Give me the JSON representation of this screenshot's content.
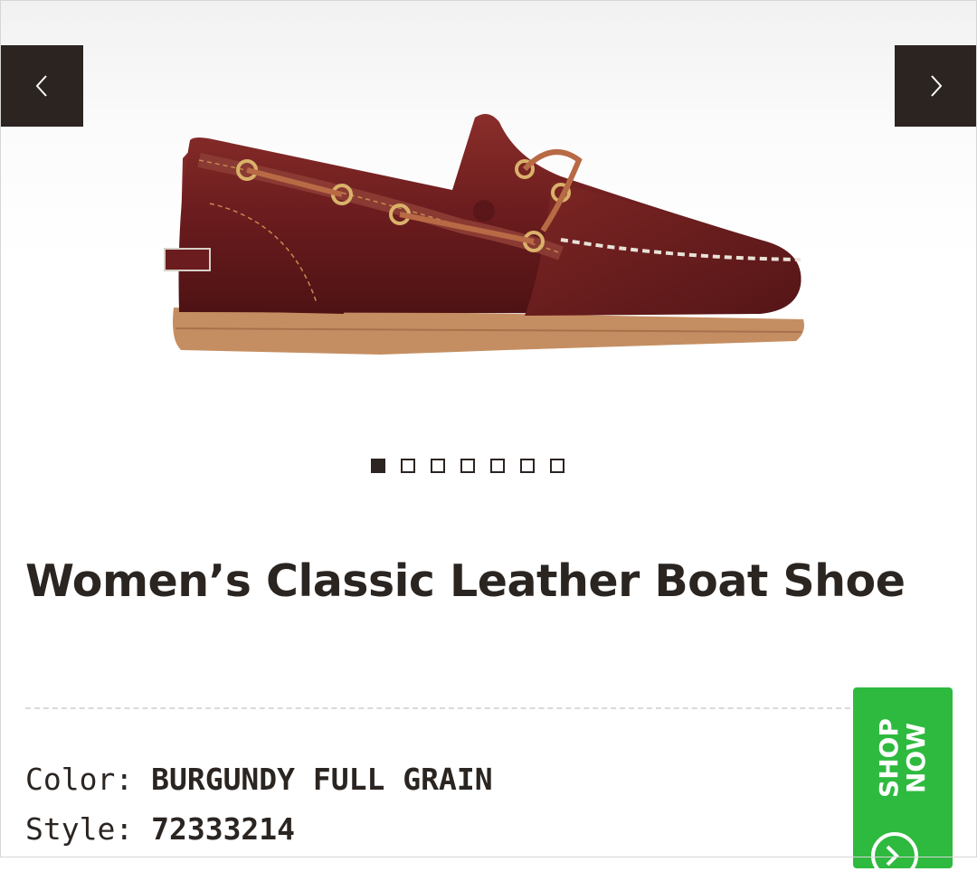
{
  "gallery": {
    "image_alt": "Women's Classic Leather Boat Shoe",
    "prev_icon": "chevron-left-icon",
    "next_icon": "chevron-right-icon",
    "slide_count": 7,
    "active_slide": 1
  },
  "product": {
    "title": "Women’s Classic Leather Boat Shoe",
    "color_label": "Color:",
    "color_value": "BURGUNDY FULL GRAIN",
    "style_label": "Style:",
    "style_value": "72333214"
  },
  "shop_now": {
    "label": "SHOP\nNOW",
    "icon": "arrow-circle-icon",
    "bg_color": "#2eba3f"
  },
  "colors": {
    "nav_bg": "#2c2421",
    "text": "#2b2522",
    "shoe_leather": "#6e1d1f",
    "sole": "#c58e62"
  }
}
